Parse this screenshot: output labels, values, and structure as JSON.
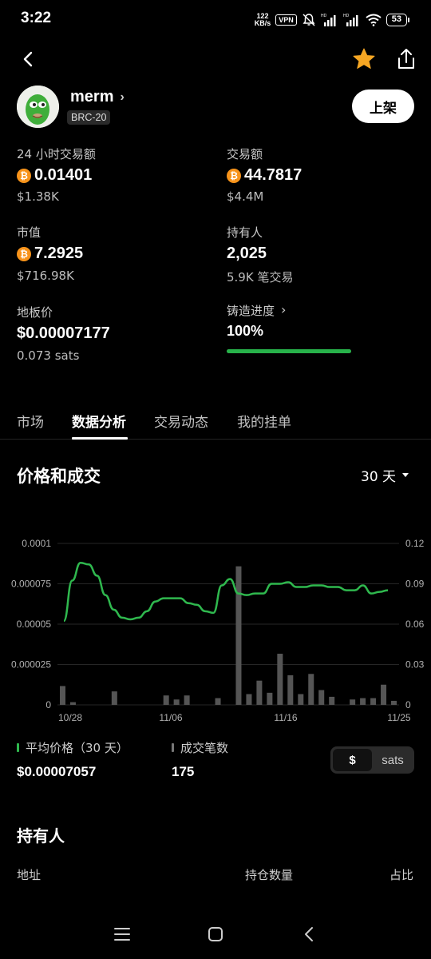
{
  "status_bar": {
    "time": "3:22",
    "net_speed_value": "122",
    "net_speed_unit": "KB/s",
    "vpn_label": "VPN",
    "battery": "53"
  },
  "header": {
    "token_name": "merm",
    "token_tag": "BRC-20",
    "list_button": "上架",
    "icons": [
      "back-arrow-icon",
      "star-icon",
      "share-icon"
    ],
    "star_color": "#f5a623"
  },
  "stats": {
    "volume_24h": {
      "label": "24 小时交易额",
      "value": "0.01401",
      "sub": "$1.38K"
    },
    "volume_total": {
      "label": "交易额",
      "value": "44.7817",
      "sub": "$4.4M"
    },
    "market_cap": {
      "label": "市值",
      "value": "7.2925",
      "sub": "$716.98K"
    },
    "holders": {
      "label": "持有人",
      "value": "2,025",
      "sub": "5.9K 笔交易"
    },
    "floor_price": {
      "label": "地板价",
      "value": "$0.00007177",
      "sub": "0.073 sats"
    },
    "mint_progress": {
      "label": "铸造进度",
      "value": "100%",
      "fraction": 1.0
    },
    "btc_symbol": "₿",
    "btc_color": "#f7931a"
  },
  "tabs": [
    {
      "label": "市场",
      "active": false
    },
    {
      "label": "数据分析",
      "active": true
    },
    {
      "label": "交易动态",
      "active": false
    },
    {
      "label": "我的挂单",
      "active": false
    }
  ],
  "price_section": {
    "title": "价格和成交",
    "range": "30 天"
  },
  "chart_data": {
    "type": "line",
    "x_tick_labels": [
      "10/28",
      "11/06",
      "11/16",
      "11/25"
    ],
    "left_axis": {
      "ticks": [
        "0",
        "0.000025",
        "0.00005",
        "0.000075",
        "0.0001"
      ],
      "ylim": [
        0,
        0.0001
      ]
    },
    "right_axis": {
      "ticks": [
        "0",
        "0.03",
        "0.06",
        "0.09",
        "0.12"
      ],
      "ylim": [
        0,
        0.12
      ]
    },
    "grid": true,
    "price_line_color": "#2fb84e",
    "volume_bar_color": "#555555",
    "series": [
      {
        "name": "平均价格（30 天）",
        "kind": "line",
        "axis": "left",
        "values": [
          5.2e-05,
          7.7e-05,
          8.8e-05,
          8.7e-05,
          8e-05,
          6.8e-05,
          5.9e-05,
          5.4e-05,
          5.3e-05,
          5.4e-05,
          5.8e-05,
          6.4e-05,
          6.6e-05,
          6.6e-05,
          6.6e-05,
          6.3e-05,
          6.2e-05,
          5.8e-05,
          5.7e-05,
          7.4e-05,
          7.8e-05,
          6.9e-05,
          6.8e-05,
          6.9e-05,
          6.9e-05,
          7.5e-05,
          7.5e-05,
          7.6e-05,
          7.3e-05,
          7.3e-05,
          7.4e-05,
          7.4e-05,
          7.3e-05,
          7.3e-05,
          7.1e-05,
          7.1e-05,
          7.4e-05,
          6.9e-05,
          7e-05,
          7.1e-05
        ]
      },
      {
        "name": "成交笔数",
        "kind": "bar",
        "axis": "right",
        "values": [
          0.014,
          0.002,
          0,
          0,
          0,
          0.01,
          0,
          0,
          0,
          0,
          0.007,
          0.004,
          0.007,
          0,
          0,
          0.005,
          0,
          0.103,
          0.008,
          0.018,
          0.009,
          0.038,
          0.022,
          0.008,
          0.023,
          0.011,
          0.006,
          0,
          0.004,
          0.005,
          0.005,
          0.015,
          0.003
        ]
      }
    ]
  },
  "legend": {
    "price": {
      "label": "平均价格（30 天）",
      "value": "$0.00007057",
      "color": "#2fb84e"
    },
    "trades": {
      "label": "成交笔数",
      "value": "175",
      "color": "#777777"
    }
  },
  "unit_toggle": {
    "options": [
      "$",
      "sats"
    ],
    "selected": "$"
  },
  "holders_section": {
    "title": "持有人",
    "columns": [
      "地址",
      "持仓数量",
      "占比"
    ]
  },
  "nav": {
    "icons": [
      "menu-icon",
      "home-square-icon",
      "back-triangle-icon"
    ]
  }
}
